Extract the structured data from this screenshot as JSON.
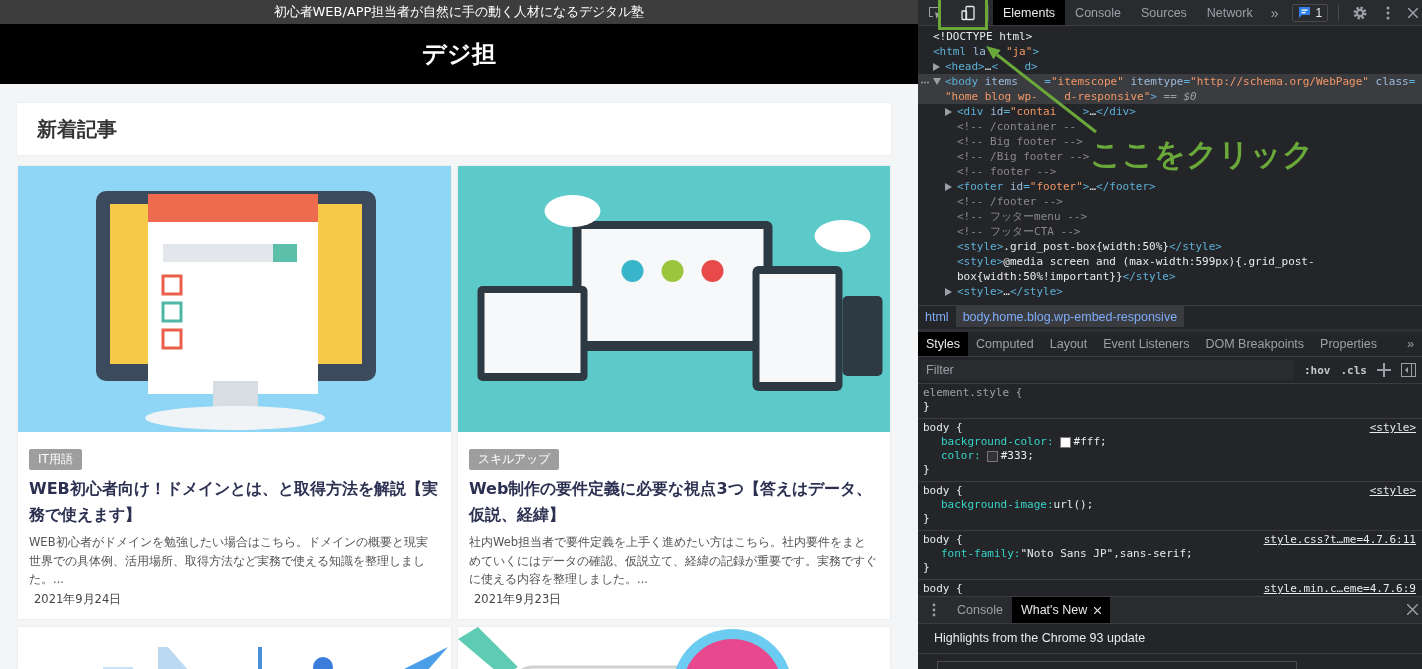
{
  "site": {
    "tagline": "初心者WEB/APP担当者が自然に手の動く人材になるデジタル塾",
    "title": "デジ担",
    "section_title": "新着記事",
    "posts": [
      {
        "image": {
          "kind": "picture"
        },
        "tag": "IT用語",
        "title": "WEB初心者向け！ドメインとは、と取得方法を解説【実務で使えます】",
        "excerpt": "WEB初心者がドメインを勉強したい場合はこちら。ドメインの概要と現実世界での具体例、活用場所、取得方法など実務で使える知識を整理しました。...",
        "date": "2021年9月24日"
      },
      {
        "image": {
          "kind": "picture"
        },
        "tag": "スキルアップ",
        "title": "Web制作の要件定義に必要な視点3つ【答えはデータ、仮説、経緯】",
        "excerpt": "社内Web担当者で要件定義を上手く進めたい方はこちら。社内要件をまとめていくにはデータの確認、仮説立て、経緯の記録が重要です。実務ですぐに使える内容を整理しました。...",
        "date": "2021年9月23日"
      },
      {
        "image": {
          "kind": "picture"
        }
      },
      {
        "image": {
          "kind": "picture"
        }
      }
    ]
  },
  "devtools": {
    "toolbar": {
      "device_toolbar_on": false,
      "tabs": [
        {
          "label": "Elements",
          "selected": true
        },
        {
          "label": "Console",
          "selected": false
        },
        {
          "label": "Sources",
          "selected": false
        },
        {
          "label": "Network",
          "selected": false
        }
      ],
      "more": "»",
      "issues_count": "1"
    },
    "dom_tree": [
      {
        "selected": false,
        "lines": [
          [
            {
              "kind": "doctype",
              "text": "<!DOCTYPE html>"
            }
          ]
        ]
      },
      {
        "selected": false,
        "lines": [
          [
            {
              "kind": "tag",
              "text": "<html "
            },
            {
              "kind": "attr",
              "text": "la   "
            },
            {
              "kind": "value",
              "text": "\"ja\""
            },
            {
              "kind": "tag",
              "text": ">"
            }
          ]
        ],
        "children": [
          {
            "expanded": false,
            "selected": false,
            "lines": [
              [
                {
                  "kind": "tag",
                  "text": "<head>"
                },
                {
                  "kind": "text",
                  "text": "…"
                },
                {
                  "kind": "tag",
                  "text": "<    d>"
                }
              ]
            ]
          },
          {
            "expanded": true,
            "selected": true,
            "lines": [
              [
                {
                  "kind": "tag",
                  "text": "<body "
                },
                {
                  "kind": "attr",
                  "text": "items    "
                },
                {
                  "kind": "tag",
                  "text": "="
                },
                {
                  "kind": "value",
                  "text": "\"itemscope\""
                },
                {
                  "kind": "attr",
                  "text": " itemtype"
                },
                {
                  "kind": "tag",
                  "text": "="
                },
                {
                  "kind": "value",
                  "text": "\"http://schema.org/WebPage\""
                },
                {
                  "kind": "attr",
                  "text": " class"
                },
                {
                  "kind": "tag",
                  "text": "="
                }
              ],
              [
                {
                  "kind": "value",
                  "text": "\"home blog wp-    d-responsive\""
                },
                {
                  "kind": "tag",
                  "text": ">"
                },
                {
                  "kind": "hint",
                  "text": " == $0"
                }
              ]
            ],
            "children": [
              {
                "expanded": false,
                "selected": false,
                "lines": [
                  [
                    {
                      "kind": "tag",
                      "text": "<div "
                    },
                    {
                      "kind": "attr",
                      "text": "id"
                    },
                    {
                      "kind": "tag",
                      "text": "="
                    },
                    {
                      "kind": "value",
                      "text": "\"contai    "
                    },
                    {
                      "kind": "tag",
                      "text": ">"
                    },
                    {
                      "kind": "text",
                      "text": "…"
                    },
                    {
                      "kind": "tag",
                      "text": "</div>"
                    }
                  ]
                ]
              },
              {
                "selected": false,
                "lines": [
                  [
                    {
                      "kind": "comment",
                      "text": "<!-- /container --"
                    }
                  ]
                ]
              },
              {
                "selected": false,
                "lines": [
                  [
                    {
                      "kind": "comment",
                      "text": "<!-- Big footer -->"
                    }
                  ]
                ]
              },
              {
                "selected": false,
                "lines": [
                  [
                    {
                      "kind": "comment",
                      "text": "<!-- /Big footer -->"
                    }
                  ]
                ]
              },
              {
                "selected": false,
                "lines": [
                  [
                    {
                      "kind": "comment",
                      "text": "<!-- footer -->"
                    }
                  ]
                ]
              },
              {
                "expanded": false,
                "selected": false,
                "lines": [
                  [
                    {
                      "kind": "tag",
                      "text": "<footer "
                    },
                    {
                      "kind": "attr",
                      "text": "id"
                    },
                    {
                      "kind": "tag",
                      "text": "="
                    },
                    {
                      "kind": "value",
                      "text": "\"footer\""
                    },
                    {
                      "kind": "tag",
                      "text": ">"
                    },
                    {
                      "kind": "text",
                      "text": "…"
                    },
                    {
                      "kind": "tag",
                      "text": "</footer>"
                    }
                  ]
                ]
              },
              {
                "selected": false,
                "lines": [
                  [
                    {
                      "kind": "comment",
                      "text": "<!-- /footer -->"
                    }
                  ]
                ]
              },
              {
                "selected": false,
                "lines": [
                  [
                    {
                      "kind": "comment",
                      "text": "<!-- フッターmenu -->"
                    }
                  ]
                ]
              },
              {
                "selected": false,
                "lines": [
                  [
                    {
                      "kind": "comment",
                      "text": "<!-- フッターCTA -->"
                    }
                  ]
                ]
              },
              {
                "selected": false,
                "lines": [
                  [
                    {
                      "kind": "tag",
                      "text": "<style>"
                    },
                    {
                      "kind": "text",
                      "text": ".grid_post-box{width:50%}"
                    },
                    {
                      "kind": "tag",
                      "text": "</style>"
                    }
                  ]
                ]
              },
              {
                "selected": false,
                "lines": [
                  [
                    {
                      "kind": "tag",
                      "text": "<style>"
                    },
                    {
                      "kind": "text",
                      "text": "@media screen and (max-width:599px){.grid_post-"
                    }
                  ],
                  [
                    {
                      "kind": "text",
                      "text": "box{width:50%!important}}"
                    },
                    {
                      "kind": "tag",
                      "text": "</style>"
                    }
                  ]
                ]
              },
              {
                "expanded": false,
                "selected": false,
                "lines": [
                  [
                    {
                      "kind": "tag",
                      "text": "<style>"
                    },
                    {
                      "kind": "text",
                      "text": "…"
                    },
                    {
                      "kind": "tag",
                      "text": "</style>"
                    }
                  ]
                ]
              }
            ]
          }
        ]
      }
    ],
    "breadcrumbs": [
      {
        "label": "html",
        "selected": false
      },
      {
        "label": "body.home.blog.wp-embed-responsive",
        "selected": true
      }
    ],
    "styles_tabs": [
      {
        "label": "Styles",
        "selected": true
      },
      {
        "label": "Computed",
        "selected": false
      },
      {
        "label": "Layout",
        "selected": false
      },
      {
        "label": "Event Listeners",
        "selected": false
      },
      {
        "label": "DOM Breakpoints",
        "selected": false
      },
      {
        "label": "Properties",
        "selected": false
      }
    ],
    "styles_more": "»",
    "filter": {
      "placeholder": "Filter"
    },
    "hov": ":hov",
    "cls": ".cls",
    "rules": [
      {
        "kind": "inline",
        "selector": "element.style {",
        "close": "}"
      },
      {
        "kind": "matched",
        "selector": "body {",
        "source": "<style>",
        "declarations": [
          {
            "property": "background-color:",
            "value": "#fff;",
            "color": "#ffffff"
          },
          {
            "property": "color:",
            "value": "#333;",
            "color": "#333333"
          }
        ],
        "close": "}"
      },
      {
        "kind": "matched",
        "selector": "body {",
        "source": "<style>",
        "declarations": [
          {
            "property": "background-image:",
            "value": "url();"
          }
        ],
        "close": "}"
      },
      {
        "kind": "matched",
        "selector": "body {",
        "source": "style.css?t…me=4.7.6:11",
        "declarations": [
          {
            "property": "font-family:",
            "value": "\"Noto Sans JP\",sans-serif;"
          }
        ],
        "close": "}"
      },
      {
        "kind": "matched",
        "selector": "body {",
        "source": "style.min.c…eme=4.7.6:9"
      }
    ],
    "drawer": {
      "tabs": [
        {
          "label": "Console",
          "selected": false,
          "closable": false
        },
        {
          "label": "What's New",
          "selected": true,
          "closable": true
        }
      ],
      "headline": "Highlights from the Chrome 93 update"
    }
  },
  "annotation": {
    "label": "ここをクリック"
  }
}
